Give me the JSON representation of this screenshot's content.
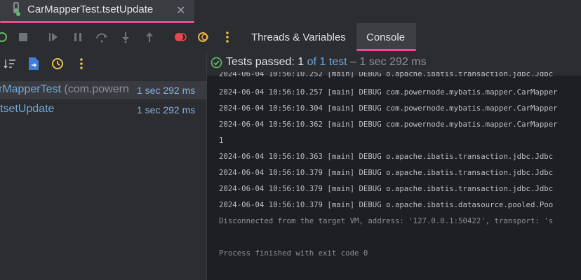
{
  "run_tab": {
    "title": "CarMapperTest.tsetUpdate",
    "close_icon": "close-icon"
  },
  "toolbar": {
    "tabs": [
      {
        "label": "Threads & Variables"
      },
      {
        "label": "Console"
      }
    ],
    "icons": [
      "rerun-icon",
      "stop-icon",
      "resume-icon",
      "pause-icon",
      "step-over-icon",
      "step-into-icon",
      "step-out-icon",
      "breakpoints-icon",
      "mute-breakpoints-icon",
      "more-icon"
    ]
  },
  "subbar": {
    "icons": [
      "sort-icon",
      "export-icon",
      "history-icon",
      "more-icon"
    ],
    "status": {
      "passed_label": "Tests passed: ",
      "passed_count": "1",
      "of_label": " of 1 test",
      "duration": " – 1 sec 292 ms"
    }
  },
  "tree": {
    "items": [
      {
        "name": "rMapperTest",
        "package": " (com.powern",
        "time": "1 sec 292 ms"
      },
      {
        "name": "tsetUpdate",
        "time": "1 sec 292 ms"
      }
    ]
  },
  "console": {
    "partial_line": "2024-06-04 10:56:10.252 [main] DEBUG o.apache.ibatis.transaction.jdbc.Jdbc",
    "lines": [
      "2024-06-04 10:56:10.257 [main] DEBUG com.powernode.mybatis.mapper.CarMapper",
      "2024-06-04 10:56:10.304 [main] DEBUG com.powernode.mybatis.mapper.CarMapper",
      "2024-06-04 10:56:10.362 [main] DEBUG com.powernode.mybatis.mapper.CarMapper",
      "1",
      "2024-06-04 10:56:10.363 [main] DEBUG o.apache.ibatis.transaction.jdbc.Jdbc",
      "2024-06-04 10:56:10.379 [main] DEBUG o.apache.ibatis.transaction.jdbc.Jdbc",
      "2024-06-04 10:56:10.379 [main] DEBUG o.apache.ibatis.transaction.jdbc.Jdbc",
      "2024-06-04 10:56:10.379 [main] DEBUG o.apache.ibatis.datasource.pooled.Poo"
    ],
    "disconnected": "Disconnected from the target VM, address: '127.0.0.1:50422', transport: 's",
    "finished": "Process finished with exit code 0"
  },
  "colors": {
    "accent": "#f04a94",
    "passed": "#5fb865",
    "link": "#6fa8dc"
  }
}
